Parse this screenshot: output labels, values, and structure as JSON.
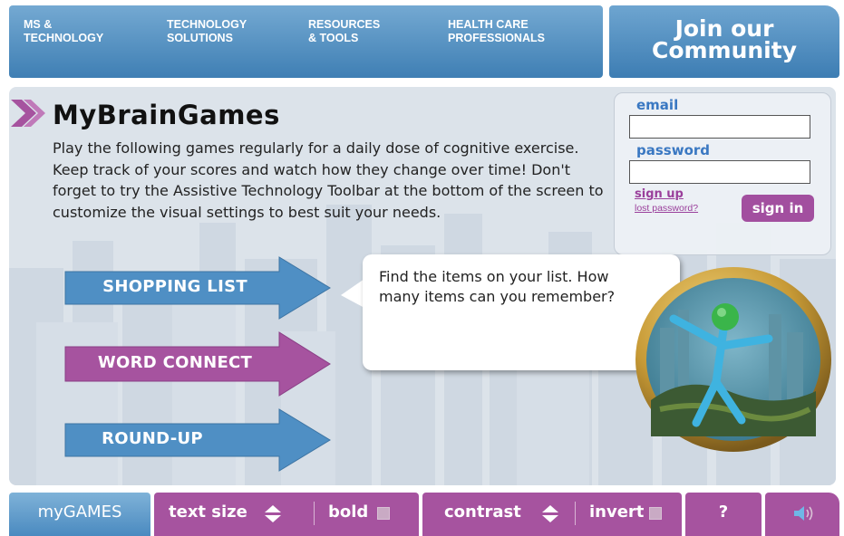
{
  "nav": {
    "items": [
      {
        "label": "MS &\nTECHNOLOGY"
      },
      {
        "label": "TECHNOLOGY\nSOLUTIONS"
      },
      {
        "label": "RESOURCES\n& TOOLS"
      },
      {
        "label": "HEALTH CARE\nPROFESSIONALS"
      }
    ],
    "join_label": "Join our\nCommunity"
  },
  "main": {
    "title": "MyBrainGames",
    "intro": "Play the following games regularly for a daily dose of cognitive exercise. Keep track of your scores and watch how they change over time! Don't forget to try the Assistive Technology Toolbar at the bottom of the screen to customize the visual settings to best suit your needs."
  },
  "login": {
    "email_label": "email",
    "email_value": "",
    "password_label": "password",
    "password_value": "",
    "signup_label": "sign up",
    "lost_password_label": "lost password?",
    "signin_label": "sign in"
  },
  "games": [
    {
      "label": "SHOPPING LIST",
      "color": "#4f8fc4"
    },
    {
      "label": "WORD CONNECT",
      "color": "#a6539f"
    },
    {
      "label": "ROUND-UP",
      "color": "#4f8fc4"
    }
  ],
  "bubble": {
    "text": "Find the items on your list. How many items can you remember?"
  },
  "toolbar": {
    "mygames_label": "myGAMES",
    "text_size_label": "text size",
    "text_size_icon": "up-down-arrows-icon",
    "bold_label": "bold",
    "bold_icon": "checkbox-icon",
    "contrast_label": "contrast",
    "contrast_icon": "up-down-arrows-icon",
    "invert_label": "invert",
    "invert_icon": "checkbox-icon",
    "help_label": "?",
    "sound_icon": "speaker-icon"
  },
  "colors": {
    "blue_accent": "#4f8fc4",
    "purple_accent": "#a6539f",
    "link_blue": "#3a78c2"
  }
}
